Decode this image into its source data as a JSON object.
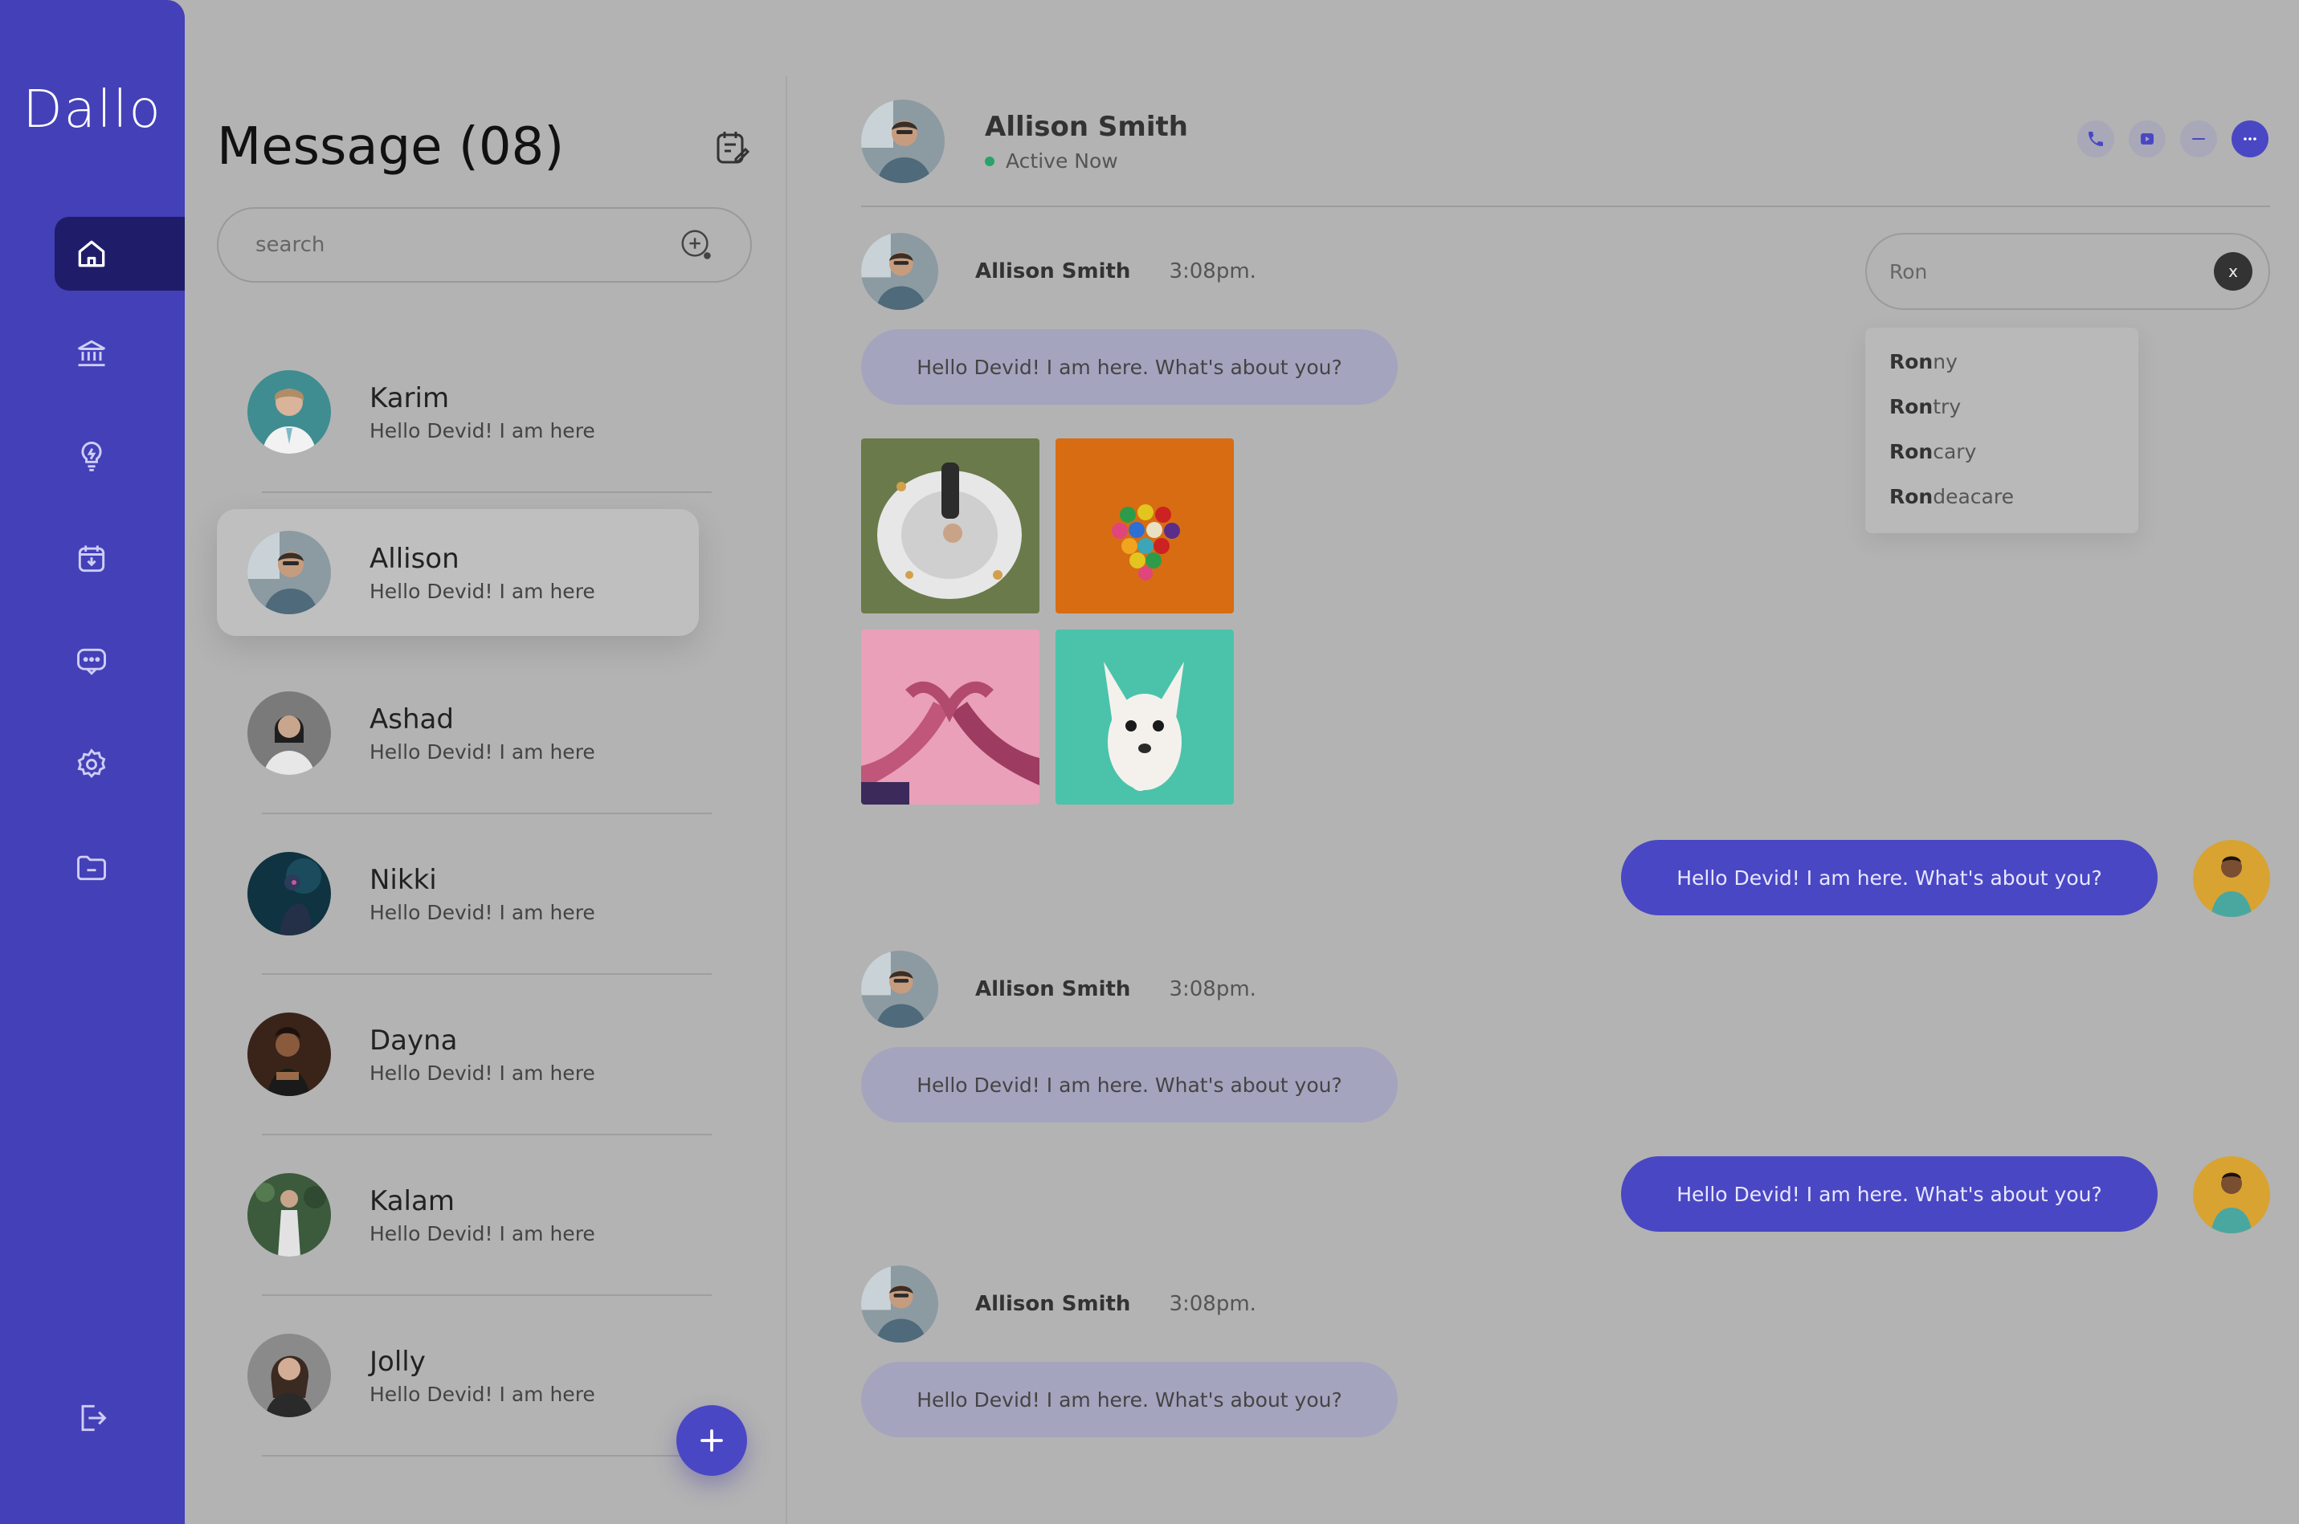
{
  "app": {
    "logo": "Dallo"
  },
  "sidebar": {
    "items": [
      {
        "icon": "home-icon",
        "active": true
      },
      {
        "icon": "bank-icon",
        "active": false
      },
      {
        "icon": "lightbulb-icon",
        "active": false
      },
      {
        "icon": "calendar-download-icon",
        "active": false
      },
      {
        "icon": "chat-icon",
        "active": false
      },
      {
        "icon": "settings-icon",
        "active": false
      },
      {
        "icon": "folder-icon",
        "active": false
      }
    ],
    "logout_icon": "logout-icon"
  },
  "messages_panel": {
    "title": "Message (08)",
    "search_placeholder": "search",
    "contacts": [
      {
        "name": "Karim",
        "snippet": "Hello Devid! I am here"
      },
      {
        "name": "Allison",
        "snippet": "Hello Devid! I am here",
        "selected": true
      },
      {
        "name": "Ashad",
        "snippet": "Hello Devid! I am here"
      },
      {
        "name": "Nikki",
        "snippet": "Hello Devid! I am here"
      },
      {
        "name": "Dayna",
        "snippet": "Hello Devid! I am here"
      },
      {
        "name": "Kalam",
        "snippet": "Hello Devid! I am here"
      },
      {
        "name": "Jolly",
        "snippet": "Hello Devid! I am here"
      }
    ]
  },
  "chat": {
    "header": {
      "name": "Allison Smith",
      "status": "Active Now"
    },
    "messages": [
      {
        "sender": "Allison Smith",
        "time": "3:08pm.",
        "text": "Hello Devid! I am here. What's about you?"
      },
      {
        "sender": "me",
        "text": "Hello Devid! I am here. What's about you?"
      },
      {
        "sender": "Allison Smith",
        "time": "3:08pm.",
        "text": "Hello Devid! I am here. What's about you?"
      },
      {
        "sender": "me",
        "text": "Hello Devid! I am here. What's about you?"
      },
      {
        "sender": "Allison Smith",
        "time": "3:08pm.",
        "text": "Hello Devid! I am here. What's about you?"
      }
    ]
  },
  "autocomplete": {
    "query": "Ron",
    "clear_label": "x",
    "suggestions": [
      {
        "match": "Ron",
        "rest": "ny"
      },
      {
        "match": "Ron",
        "rest": "try"
      },
      {
        "match": "Ron",
        "rest": "cary"
      },
      {
        "match": "Ron",
        "rest": "deacare"
      }
    ]
  },
  "colors": {
    "accent": "#4a47c4",
    "sidebar": "#4340b8",
    "overlay": "#b3b3b3"
  }
}
